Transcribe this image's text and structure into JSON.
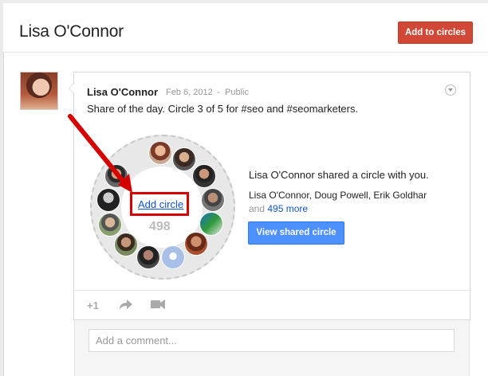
{
  "profile": {
    "name": "Lisa O'Connor",
    "add_button_label": "Add to circles"
  },
  "post": {
    "author": "Lisa O'Connor",
    "date": "Feb 6, 2012",
    "separator": "-",
    "visibility": "Public",
    "text": "Share of the day. Circle 3 of 5 for #seo and #seomarketers."
  },
  "circle": {
    "add_label": "Add circle",
    "count": "498",
    "share_title": "Lisa O'Connor shared a circle with you.",
    "people": [
      "Lisa O'Connor",
      "Doug Powell",
      "Erik Goldhar"
    ],
    "people_sep": ", ",
    "more_prefix": "and",
    "more_link": "495 more",
    "view_button_label": "View shared circle"
  },
  "actions": {
    "plus_one": "+1"
  },
  "comment": {
    "placeholder": "Add a comment..."
  },
  "colors": {
    "red_button": "#d14836",
    "blue_button": "#4d90fe",
    "link": "#1155cc",
    "highlight": "#d50000"
  }
}
